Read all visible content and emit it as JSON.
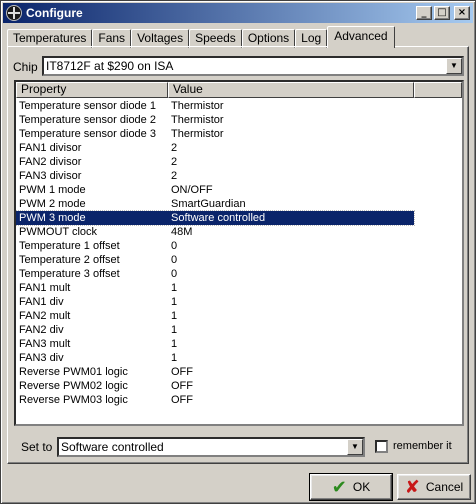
{
  "window": {
    "title": "Configure",
    "controls": {
      "minimize": "_",
      "maximize": "□",
      "close": "×"
    }
  },
  "tabs": [
    {
      "label": "Temperatures",
      "active": false
    },
    {
      "label": "Fans",
      "active": false
    },
    {
      "label": "Voltages",
      "active": false
    },
    {
      "label": "Speeds",
      "active": false
    },
    {
      "label": "Options",
      "active": false
    },
    {
      "label": "Log",
      "active": false
    },
    {
      "label": "Advanced",
      "active": true
    }
  ],
  "chip": {
    "label": "Chip",
    "value": "IT8712F at $290 on ISA"
  },
  "list": {
    "columns": {
      "property": "Property",
      "value": "Value"
    },
    "rows": [
      {
        "property": "Temperature sensor diode 1",
        "value": "Thermistor"
      },
      {
        "property": "Temperature sensor diode 2",
        "value": "Thermistor"
      },
      {
        "property": "Temperature sensor diode 3",
        "value": "Thermistor"
      },
      {
        "property": "FAN1 divisor",
        "value": "2"
      },
      {
        "property": "FAN2 divisor",
        "value": "2"
      },
      {
        "property": "FAN3 divisor",
        "value": "2"
      },
      {
        "property": "PWM 1 mode",
        "value": "ON/OFF"
      },
      {
        "property": "PWM 2 mode",
        "value": "SmartGuardian"
      },
      {
        "property": "PWM 3 mode",
        "value": "Software controlled",
        "selected": true
      },
      {
        "property": "PWMOUT clock",
        "value": "48M"
      },
      {
        "property": "Temperature 1 offset",
        "value": "0"
      },
      {
        "property": "Temperature 2 offset",
        "value": "0"
      },
      {
        "property": "Temperature 3 offset",
        "value": "0"
      },
      {
        "property": "FAN1 mult",
        "value": "1"
      },
      {
        "property": "FAN1 div",
        "value": "1"
      },
      {
        "property": "FAN2 mult",
        "value": "1"
      },
      {
        "property": "FAN2 div",
        "value": "1"
      },
      {
        "property": "FAN3 mult",
        "value": "1"
      },
      {
        "property": "FAN3 div",
        "value": "1"
      },
      {
        "property": "Reverse PWM01 logic",
        "value": "OFF"
      },
      {
        "property": "Reverse PWM02 logic",
        "value": "OFF"
      },
      {
        "property": "Reverse PWM03 logic",
        "value": "OFF"
      }
    ]
  },
  "setto": {
    "label": "Set to",
    "value": "Software controlled",
    "remember_label": "remember it",
    "remember_checked": false
  },
  "buttons": {
    "ok": "OK",
    "cancel": "Cancel"
  },
  "colors": {
    "selection": "#0a246a",
    "face": "#d4d0c8"
  }
}
